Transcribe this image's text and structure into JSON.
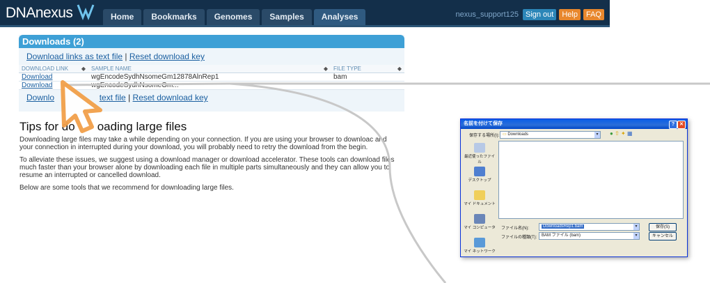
{
  "header": {
    "logo_text": "DNAnexus",
    "nav": [
      "Home",
      "Bookmarks",
      "Genomes",
      "Samples",
      "Analyses"
    ],
    "username": "nexus_support125",
    "signout_label": "Sign out",
    "help_label": "Help",
    "faq_label": "FAQ"
  },
  "downloads": {
    "title": "Downloads (2)",
    "link_text_file": "Download links as text file",
    "separator": "|",
    "reset_key": "Reset download key",
    "columns": [
      "DOWNLOAD LINK",
      "SAMPLE NAME",
      "FILE TYPE"
    ],
    "rows": [
      {
        "link": "Download",
        "sample": "wgEncodeSydhNsomeGm12878AlnRep1",
        "type": "bam"
      },
      {
        "link": "Download",
        "sample": "wgEncodeSydhNsomeGm...",
        "type": ""
      }
    ],
    "bottom_link_a": "Downlo",
    "bottom_link_b": "text file",
    "bottom_reset": "Reset download key"
  },
  "tips": {
    "heading_a": "Tips for ",
    "heading_b": "do",
    "heading_c": "oading large files",
    "p1": "Downloading large files may take a while depending on your connection. If you are using your browser to downloac and your connection in interrupted during your download, you will probably need to retry the download from the begin.",
    "p2": "To alleviate these issues, we suggest using a download manager or download accelerator. These tools can download files much faster than your browser alone by downloading each file in multiple parts simultaneously and they can allow you to resume an interrupted or cancelled download.",
    "p3": "Below are some tools that we recommend for downloading large files."
  },
  "dialog": {
    "title": "名前を付けて保存",
    "save_in_label": "保存する場所(I):",
    "save_in_value": "Downloads",
    "places": [
      "最近使ったファイル",
      "デスクトップ",
      "マイ ドキュメント",
      "マイ コンピュータ",
      "マイ ネットワーク"
    ],
    "filename_label": "ファイル名(N):",
    "filename_value": "DownloadsRep1.bam",
    "filetype_label": "ファイルの種類(T):",
    "filetype_value": "BAM ファイル (bam)",
    "save_label": "保存(S)",
    "cancel_label": "キャンセル"
  },
  "colors": {
    "header_bg": "#132f4a",
    "panel_head": "#3ea0d6",
    "accent_orange": "#e8872d",
    "link": "#1a5fa0"
  }
}
